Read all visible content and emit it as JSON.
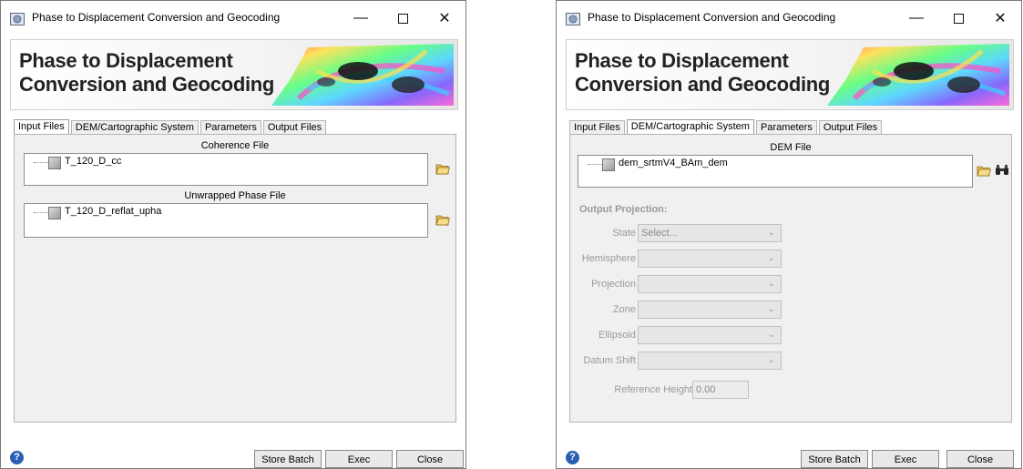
{
  "windows": [
    {
      "title": "Phase to Displacement Conversion and Geocoding",
      "banner_title_line1": "Phase to Displacement",
      "banner_title_line2": "Conversion and Geocoding",
      "tabs": [
        "Input Files",
        "DEM/Cartographic System",
        "Parameters",
        "Output Files"
      ],
      "active_tab": "Input Files",
      "coherence_label": "Coherence File",
      "coherence_file": "T_120_D_cc",
      "unwrapped_label": "Unwrapped Phase File",
      "unwrapped_file": "T_120_D_reflat_upha",
      "buttons": {
        "store_batch": "Store Batch",
        "exec": "Exec",
        "close": "Close"
      }
    },
    {
      "title": "Phase to Displacement Conversion and Geocoding",
      "banner_title_line1": "Phase to Displacement",
      "banner_title_line2": "Conversion and Geocoding",
      "tabs": [
        "Input Files",
        "DEM/Cartographic System",
        "Parameters",
        "Output Files"
      ],
      "active_tab": "DEM/Cartographic System",
      "dem_label": "DEM File",
      "dem_file": "dem_srtmV4_BAm_dem",
      "output_projection_label": "Output Projection:",
      "fields": [
        {
          "label": "State",
          "value": "Select..."
        },
        {
          "label": "Hemisphere",
          "value": ""
        },
        {
          "label": "Projection",
          "value": ""
        },
        {
          "label": "Zone",
          "value": ""
        },
        {
          "label": "Ellipsoid",
          "value": ""
        },
        {
          "label": "Datum Shift",
          "value": ""
        }
      ],
      "reference_height_label": "Reference Height",
      "reference_height_value": "0.00",
      "buttons": {
        "store_batch": "Store Batch",
        "exec": "Exec",
        "close": "Close"
      }
    }
  ],
  "icons": {
    "app": "window-app-icon",
    "minimize": "minimize-icon",
    "maximize": "maximize-icon",
    "close": "close-icon",
    "folder": "folder-open-icon",
    "binoculars": "binoculars-icon",
    "help": "help-icon",
    "file": "raster-file-icon"
  }
}
